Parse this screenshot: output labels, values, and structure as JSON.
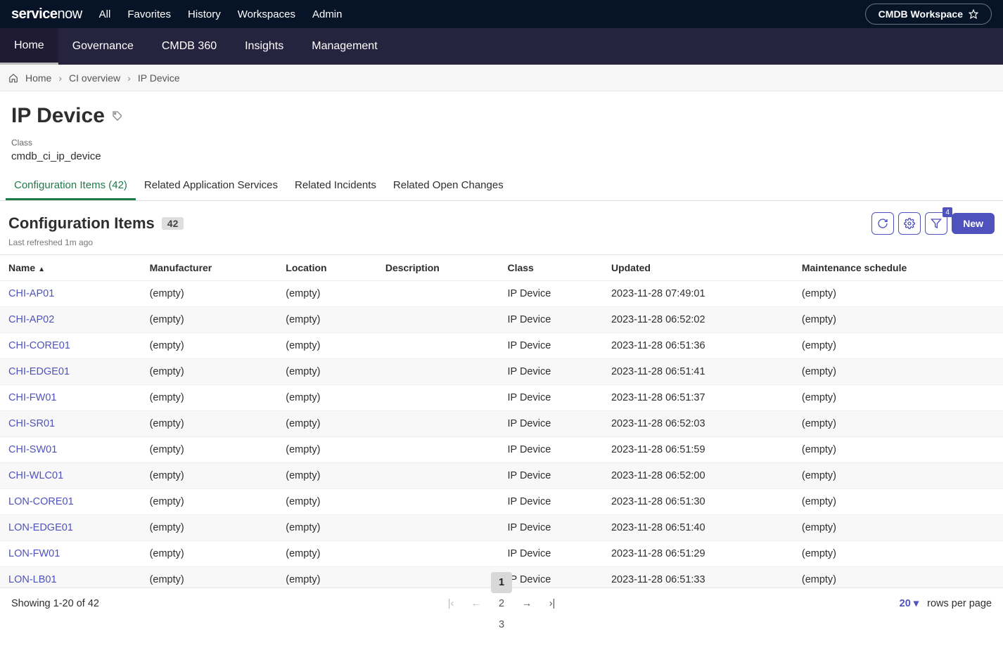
{
  "topNav": {
    "all": "All",
    "favorites": "Favorites",
    "history": "History",
    "workspaces": "Workspaces",
    "admin": "Admin",
    "workspace_pill": "CMDB Workspace"
  },
  "mainNav": [
    "Home",
    "Governance",
    "CMDB 360",
    "Insights",
    "Management"
  ],
  "breadcrumb": {
    "home": "Home",
    "ci_overview": "CI overview",
    "current": "IP Device"
  },
  "header": {
    "title": "IP Device",
    "class_label": "Class",
    "class_value": "cmdb_ci_ip_device"
  },
  "tabs": [
    {
      "label": "Configuration Items (42)",
      "active": true
    },
    {
      "label": "Related Application Services",
      "active": false
    },
    {
      "label": "Related Incidents",
      "active": false
    },
    {
      "label": "Related Open Changes",
      "active": false
    }
  ],
  "section": {
    "title": "Configuration Items",
    "count": "42",
    "refreshed": "Last refreshed 1m ago",
    "new_label": "New",
    "filter_badge": "4"
  },
  "columns": [
    "Name",
    "Manufacturer",
    "Location",
    "Description",
    "Class",
    "Updated",
    "Maintenance schedule"
  ],
  "sort_col": "Name",
  "rows": [
    {
      "name": "CHI-AP01",
      "manufacturer": "(empty)",
      "location": "(empty)",
      "description": "",
      "class": "IP Device",
      "updated": "2023-11-28 07:49:01",
      "maint": "(empty)"
    },
    {
      "name": "CHI-AP02",
      "manufacturer": "(empty)",
      "location": "(empty)",
      "description": "",
      "class": "IP Device",
      "updated": "2023-11-28 06:52:02",
      "maint": "(empty)"
    },
    {
      "name": "CHI-CORE01",
      "manufacturer": "(empty)",
      "location": "(empty)",
      "description": "",
      "class": "IP Device",
      "updated": "2023-11-28 06:51:36",
      "maint": "(empty)"
    },
    {
      "name": "CHI-EDGE01",
      "manufacturer": "(empty)",
      "location": "(empty)",
      "description": "",
      "class": "IP Device",
      "updated": "2023-11-28 06:51:41",
      "maint": "(empty)"
    },
    {
      "name": "CHI-FW01",
      "manufacturer": "(empty)",
      "location": "(empty)",
      "description": "",
      "class": "IP Device",
      "updated": "2023-11-28 06:51:37",
      "maint": "(empty)"
    },
    {
      "name": "CHI-SR01",
      "manufacturer": "(empty)",
      "location": "(empty)",
      "description": "",
      "class": "IP Device",
      "updated": "2023-11-28 06:52:03",
      "maint": "(empty)"
    },
    {
      "name": "CHI-SW01",
      "manufacturer": "(empty)",
      "location": "(empty)",
      "description": "",
      "class": "IP Device",
      "updated": "2023-11-28 06:51:59",
      "maint": "(empty)"
    },
    {
      "name": "CHI-WLC01",
      "manufacturer": "(empty)",
      "location": "(empty)",
      "description": "",
      "class": "IP Device",
      "updated": "2023-11-28 06:52:00",
      "maint": "(empty)"
    },
    {
      "name": "LON-CORE01",
      "manufacturer": "(empty)",
      "location": "(empty)",
      "description": "",
      "class": "IP Device",
      "updated": "2023-11-28 06:51:30",
      "maint": "(empty)"
    },
    {
      "name": "LON-EDGE01",
      "manufacturer": "(empty)",
      "location": "(empty)",
      "description": "",
      "class": "IP Device",
      "updated": "2023-11-28 06:51:40",
      "maint": "(empty)"
    },
    {
      "name": "LON-FW01",
      "manufacturer": "(empty)",
      "location": "(empty)",
      "description": "",
      "class": "IP Device",
      "updated": "2023-11-28 06:51:29",
      "maint": "(empty)"
    },
    {
      "name": "LON-LB01",
      "manufacturer": "(empty)",
      "location": "(empty)",
      "description": "",
      "class": "IP Device",
      "updated": "2023-11-28 06:51:33",
      "maint": "(empty)"
    }
  ],
  "pager": {
    "showing": "Showing 1-20 of 42",
    "pages": [
      "1",
      "2",
      "3"
    ],
    "current": "1",
    "rpp_value": "20",
    "rpp_label": "rows per page"
  }
}
